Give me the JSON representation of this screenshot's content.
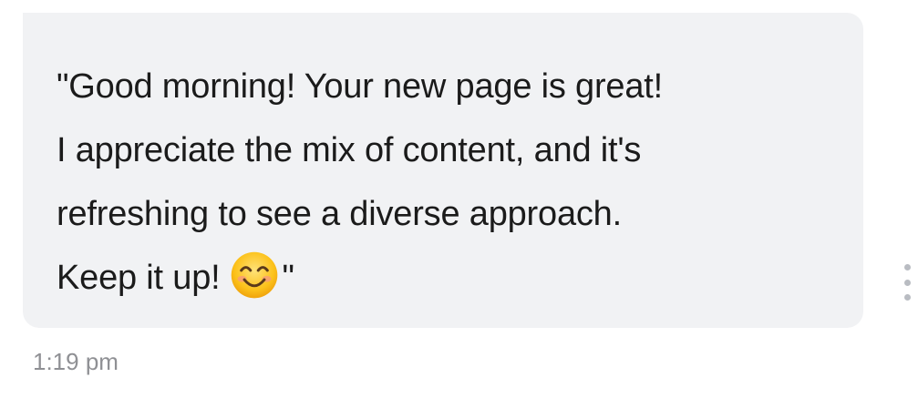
{
  "message": {
    "lines": [
      "\"Good morning! Your new page is great!",
      "I appreciate the mix of content, and it's",
      "refreshing to see a diverse approach.",
      "Keep it up!"
    ],
    "closing_quote": "\"",
    "emoji": "smiling-face-with-smiling-eyes-icon",
    "timestamp": "1:19 pm"
  },
  "more_menu": {
    "icon": "vertical-ellipsis-icon"
  },
  "colors": {
    "bubble_background": "#f1f2f4",
    "message_text": "#1b1b1b",
    "timestamp_text": "#8f9094",
    "menu_dots": "#b9bcc2",
    "emoji_face": "#fcc21b"
  }
}
